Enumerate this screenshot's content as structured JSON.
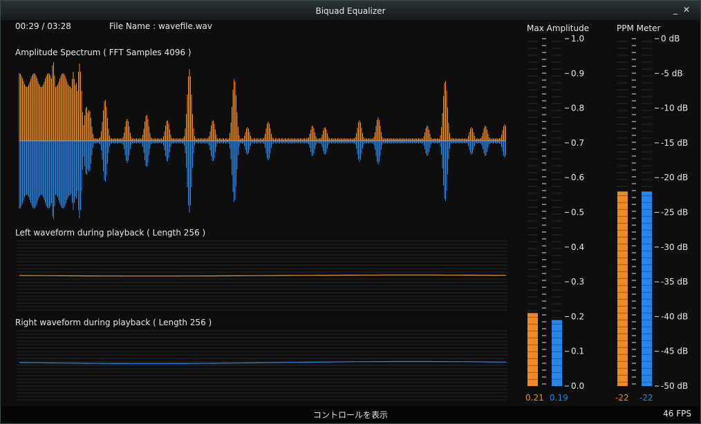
{
  "window": {
    "title": "Biquad Equalizer",
    "minimize_icon": "minimize-icon",
    "close_icon": "close-icon"
  },
  "header": {
    "time": "00:29 / 03:28",
    "file_label": "File Name : wavefile.wav"
  },
  "spectrum": {
    "title": "Amplitude Spectrum ( FFT Samples 4096 )"
  },
  "left_wave": {
    "title": "Left waveform during playback ( Length 256 )"
  },
  "right_wave": {
    "title": "Right waveform during playback ( Length 256 )"
  },
  "max_amplitude": {
    "title": "Max Amplitude",
    "ticks": [
      "1.0",
      "0.9",
      "0.8",
      "0.7",
      "0.6",
      "0.5",
      "0.4",
      "0.3",
      "0.2",
      "0.1",
      "0.0"
    ],
    "left_value": 0.21,
    "right_value": 0.19,
    "left_label": "0.21",
    "right_label": "0.19"
  },
  "ppm": {
    "title": "PPM Meter",
    "ticks": [
      "0 dB",
      "-5 dB",
      "-10 dB",
      "-15 dB",
      "-20 dB",
      "-25 dB",
      "-30 dB",
      "-35 dB",
      "-40 dB",
      "-45 dB",
      "-50 dB"
    ],
    "left_value": -22,
    "right_value": -22,
    "left_label": "-22",
    "right_label": "-22"
  },
  "footer": {
    "controls_label": "コントロールを表示",
    "fps_label": "46 FPS"
  },
  "colors": {
    "left": "#f08a24",
    "right": "#2a86e6",
    "background": "#0e0e0e"
  }
}
